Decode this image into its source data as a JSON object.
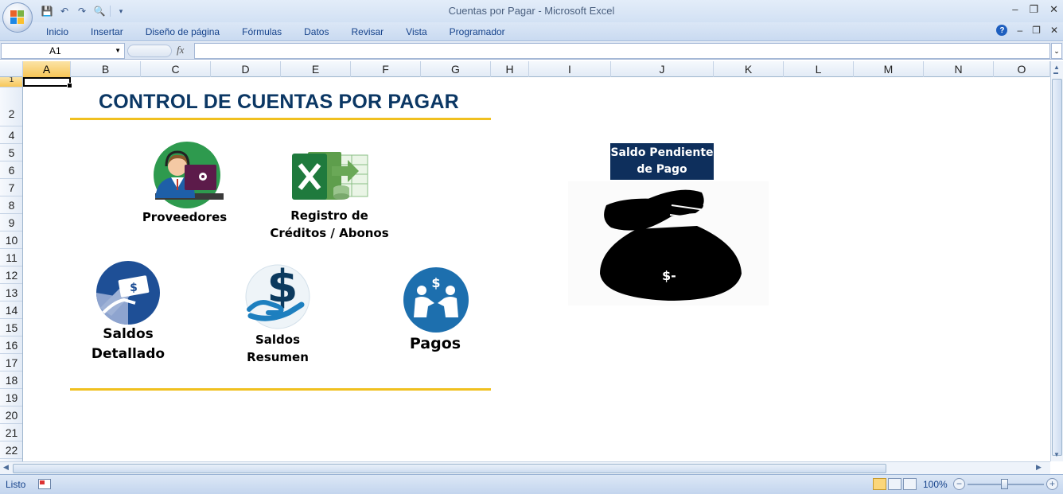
{
  "window": {
    "title": "Cuentas por Pagar - Microsoft Excel",
    "controls": [
      "–",
      "❐",
      "✕"
    ],
    "inner_controls": [
      "–",
      "❐",
      "✕"
    ]
  },
  "ribbon": {
    "tabs": [
      "Inicio",
      "Insertar",
      "Diseño de página",
      "Fórmulas",
      "Datos",
      "Revisar",
      "Vista",
      "Programador"
    ]
  },
  "formula_bar": {
    "name_box": "A1",
    "fx_label": "fx",
    "formula": ""
  },
  "grid": {
    "columns": [
      "A",
      "B",
      "C",
      "D",
      "E",
      "F",
      "G",
      "H",
      "I",
      "J",
      "K",
      "L",
      "M",
      "N",
      "O"
    ],
    "active_column": "A",
    "rows": [
      "1",
      "2",
      "4",
      "5",
      "6",
      "7",
      "8",
      "9",
      "10",
      "11",
      "12",
      "13",
      "14",
      "15",
      "16",
      "17",
      "18",
      "19",
      "20",
      "21",
      "22"
    ],
    "active_row": "1"
  },
  "dashboard": {
    "title": "CONTROL DE CUENTAS POR PAGAR",
    "buttons": {
      "proveedores": "Proveedores",
      "registro_line1": "Registro de",
      "registro_line2": "Créditos / Abonos",
      "saldos_detallado_line1": "Saldos",
      "saldos_detallado_line2": "Detallado",
      "saldos_resumen_line1": "Saldos",
      "saldos_resumen_line2": "Resumen",
      "pagos": "Pagos"
    },
    "saldo": {
      "header_line1": "Saldo Pendiente",
      "header_line2": "de Pago",
      "value": "$-"
    },
    "colors": {
      "title": "#0b3764",
      "accent_line": "#f0c020",
      "saldo_header_bg": "#0e2f5c"
    }
  },
  "status_bar": {
    "status": "Listo",
    "zoom": "100%"
  }
}
